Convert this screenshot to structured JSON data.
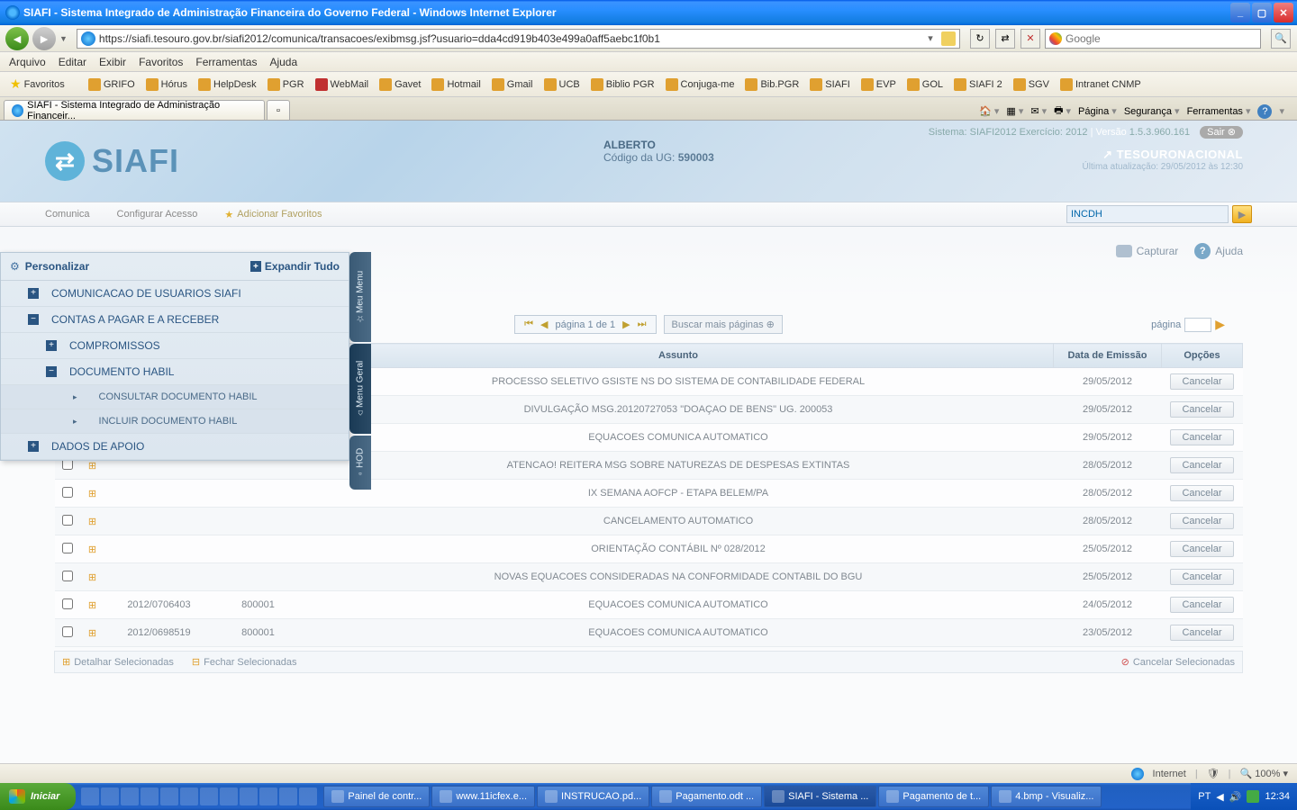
{
  "window": {
    "title": "SIAFI - Sistema Integrado de Administração Financeira do Governo Federal - Windows Internet Explorer"
  },
  "nav": {
    "url": "https://siafi.tesouro.gov.br/siafi2012/comunica/transacoes/exibmsg.jsf?usuario=dda4cd919b403e499a0aff5aebc1f0b1",
    "search_placeholder": "Google"
  },
  "menus": [
    "Arquivo",
    "Editar",
    "Exibir",
    "Favoritos",
    "Ferramentas",
    "Ajuda"
  ],
  "favorites_label": "Favoritos",
  "favorites": [
    "GRIFO",
    "Hórus",
    "HelpDesk",
    "PGR",
    "WebMail",
    "Gavet",
    "Hotmail",
    "Gmail",
    "UCB",
    "Biblio PGR",
    "Conjuga-me",
    "Bib.PGR",
    "SIAFI",
    "EVP",
    "GOL",
    "SIAFI 2",
    "SGV",
    "Intranet CNMP"
  ],
  "tab": {
    "title": "SIAFI - Sistema Integrado de Administração Financeir..."
  },
  "cmdbar": [
    "Página",
    "Segurança",
    "Ferramentas"
  ],
  "siafi": {
    "logo": "SIAFI",
    "user_name": "ALBERTO",
    "ug_label": "Código da UG:",
    "ug_value": "590003",
    "sistema": "Sistema: SIAFI2012 Exercício: 2012",
    "versao_label": "| Versão",
    "versao_value": "1.5.3.960.161",
    "sair": "Sair",
    "tesouro": "TESOURONACIONAL",
    "ultima": "Última atualização: 29/05/2012 às 12:30",
    "menu": {
      "comunica": "Comunica",
      "config": "Configurar Acesso",
      "addfav": "Adicionar Favoritos"
    },
    "search_value": "INCDH",
    "capturar": "Capturar",
    "ajuda": "Ajuda",
    "paginator": "página 1 de 1",
    "buscar": "Buscar mais páginas",
    "pagina_label": "página"
  },
  "sidemenu": {
    "personalizar": "Personalizar",
    "expandir": "Expandir Tudo",
    "items": {
      "comunicacao": "COMUNICACAO DE USUARIOS SIAFI",
      "contas": "CONTAS A PAGAR E A RECEBER",
      "compromissos": "COMPROMISSOS",
      "documento": "DOCUMENTO HABIL",
      "consultar": "CONSULTAR DOCUMENTO HABIL",
      "incluir": "INCLUIR DOCUMENTO HABIL",
      "dados": "DADOS DE APOIO"
    }
  },
  "vtabs": {
    "meu": "Meu Menu",
    "geral": "Menu Geral",
    "hod": "HOD"
  },
  "table": {
    "headers": {
      "assunto": "Assunto",
      "data": "Data de Emissão",
      "opcoes": "Opções"
    },
    "cancel": "Cancelar",
    "rows": [
      {
        "assunto": "PROCESSO SELETIVO GSISTE NS DO SISTEMA DE CONTABILIDADE FEDERAL",
        "data": "29/05/2012"
      },
      {
        "assunto": "DIVULGAÇÃO MSG.20120727053 \"DOAÇAO DE BENS\" UG. 200053",
        "data": "29/05/2012"
      },
      {
        "assunto": "EQUACOES COMUNICA AUTOMATICO",
        "data": "29/05/2012"
      },
      {
        "assunto": "ATENCAO! REITERA MSG SOBRE NATUREZAS DE DESPESAS EXTINTAS",
        "data": "28/05/2012"
      },
      {
        "assunto": "IX SEMANA AOFCP - ETAPA BELEM/PA",
        "data": "28/05/2012"
      },
      {
        "assunto": "CANCELAMENTO AUTOMATICO",
        "data": "28/05/2012"
      },
      {
        "assunto": "ORIENTAÇÃO CONTÁBIL Nº 028/2012",
        "data": "25/05/2012"
      },
      {
        "assunto": "NOVAS EQUACOES CONSIDERADAS NA CONFORMIDADE CONTABIL DO BGU",
        "data": "25/05/2012"
      },
      {
        "assunto": "EQUACOES COMUNICA AUTOMATICO",
        "data": "24/05/2012",
        "num": "2012/0706403",
        "cod": "800001"
      },
      {
        "assunto": "EQUACOES COMUNICA AUTOMATICO",
        "data": "23/05/2012",
        "num": "2012/0698519",
        "cod": "800001"
      }
    ],
    "footer": {
      "detalhar": "Detalhar Selecionadas",
      "fechar": "Fechar Selecionadas",
      "cancelar": "Cancelar Selecionadas"
    }
  },
  "statusbar": {
    "internet": "Internet",
    "zoom": "100%"
  },
  "taskbar": {
    "start": "Iniciar",
    "tasks": [
      "Painel de contr...",
      "www.11icfex.e...",
      "INSTRUCAO.pd...",
      "Pagamento.odt ...",
      "SIAFI - Sistema ...",
      "Pagamento de t...",
      "4.bmp - Visualiz..."
    ],
    "lang": "PT",
    "time": "12:34"
  }
}
